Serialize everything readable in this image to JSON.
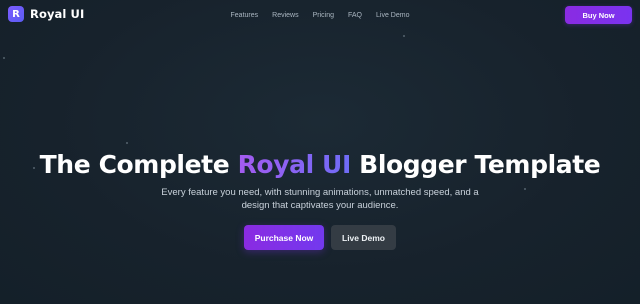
{
  "brand": {
    "logo_letter": "R",
    "name": "Royal UI",
    "logo_color": "#6e5cf6"
  },
  "nav": {
    "items": [
      "Features",
      "Reviews",
      "Pricing",
      "FAQ",
      "Live Demo"
    ]
  },
  "header": {
    "buy_label": "Buy Now"
  },
  "hero": {
    "title_before": "The Complete ",
    "title_accent": "Royal UI",
    "title_after": " Blogger Template",
    "subtitle": "Every feature you need, with stunning animations, unmatched speed, and a design that captivates your audience.",
    "primary_cta": "Purchase Now",
    "secondary_cta": "Live Demo"
  },
  "colors": {
    "background": "#17222c",
    "accent_purple": "#8a2be2",
    "accent_gradient_end": "#6f6cf6",
    "secondary_button": "#343c44"
  }
}
